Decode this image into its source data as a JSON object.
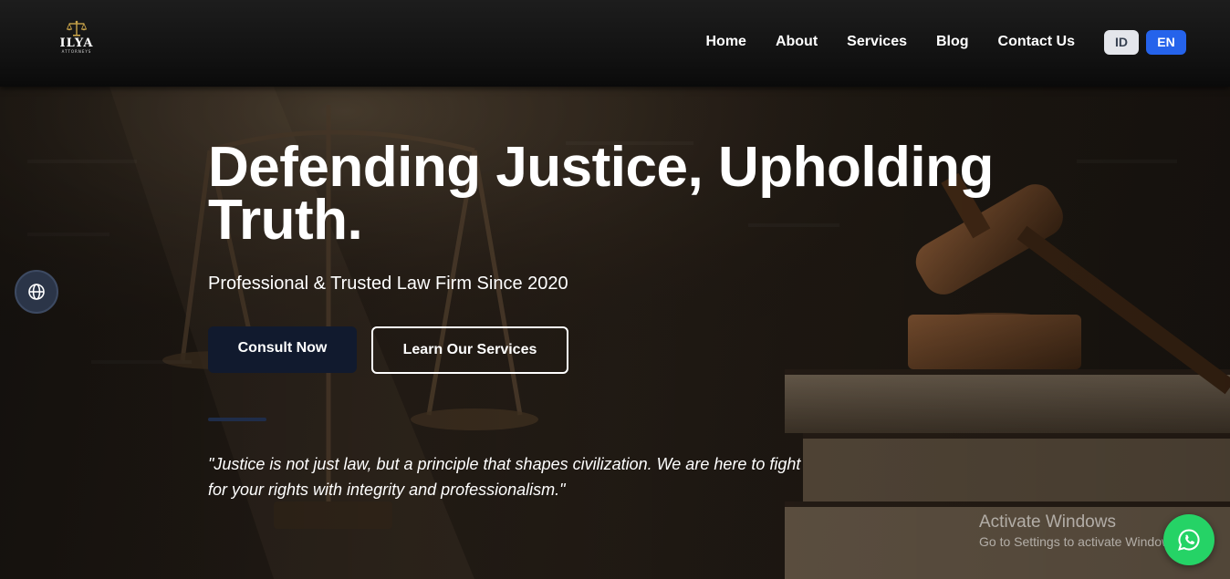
{
  "brand": {
    "name": "ILYA",
    "subtitle": "ATTORNEYS",
    "logo_icon": "scales-of-justice-icon"
  },
  "nav": {
    "items": [
      {
        "label": "Home"
      },
      {
        "label": "About"
      },
      {
        "label": "Services"
      },
      {
        "label": "Blog"
      },
      {
        "label": "Contact Us"
      }
    ]
  },
  "language": {
    "options": [
      "ID",
      "EN"
    ],
    "active": "EN"
  },
  "hero": {
    "title": "Defending Justice, Upholding Truth.",
    "subtitle": "Professional & Trusted Law Firm Since 2020",
    "primary_cta": "Consult Now",
    "secondary_cta": "Learn Our Services",
    "quote": "\"Justice is not just law, but a principle that shapes civilization. We are here to fight for your rights with integrity and professionalism.\""
  },
  "floating": {
    "globe_icon": "globe-icon",
    "whatsapp_icon": "whatsapp-icon"
  },
  "os_watermark": {
    "title": "Activate Windows",
    "subtitle": "Go to Settings to activate Windows."
  },
  "colors": {
    "header_bg": "#141414",
    "accent_blue": "#2563eb",
    "primary_button": "#111a2e",
    "whatsapp_green": "#25d366",
    "lang_inactive": "#e4e6eb"
  }
}
